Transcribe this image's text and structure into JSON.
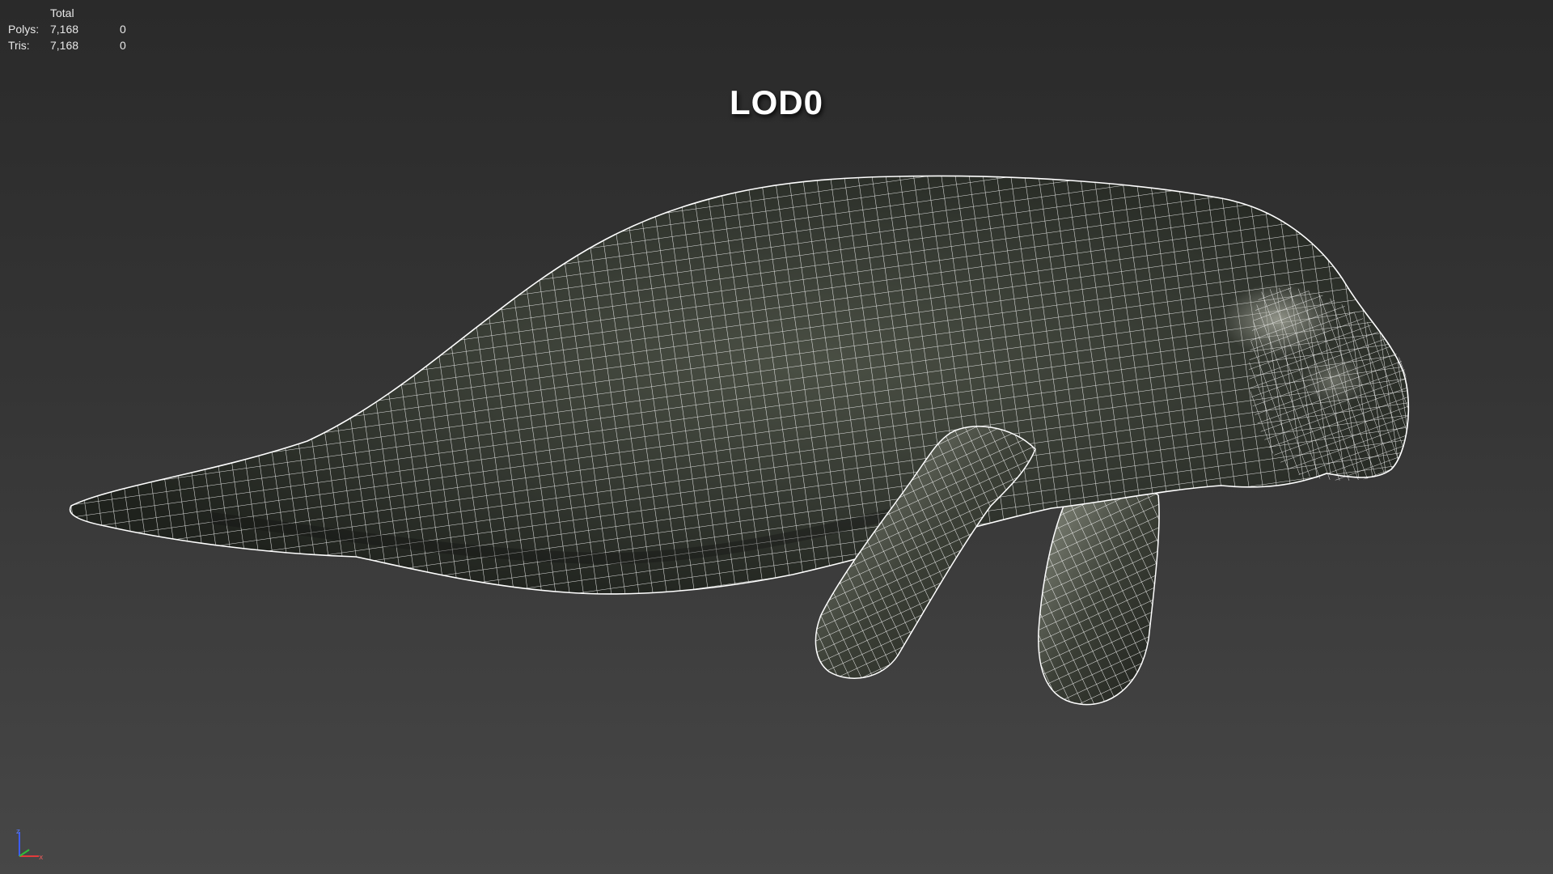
{
  "stats": {
    "header": "Total",
    "rows": [
      {
        "label": "Polys:",
        "total": "7,168",
        "selected": "0"
      },
      {
        "label": "Tris:",
        "total": "7,168",
        "selected": "0"
      }
    ]
  },
  "viewport": {
    "title": "LOD0",
    "model_icon": "manatee-wireframe",
    "axis_labels": {
      "z": "z",
      "x": "x"
    }
  },
  "colors": {
    "background_top": "#2a2a2a",
    "background_bottom": "#474747",
    "wire": "#ffffff",
    "skin": "#3a3f36"
  }
}
